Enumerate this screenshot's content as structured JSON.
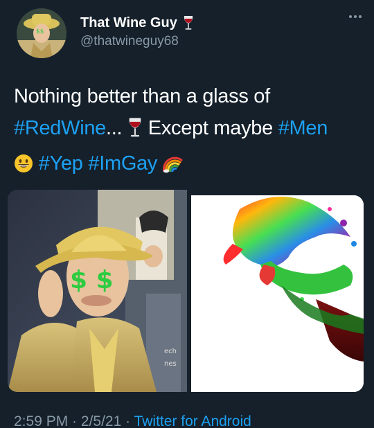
{
  "author": {
    "display_name": "That Wine Guy",
    "handle": "@thatwineguy68"
  },
  "text": {
    "line1": "Nothing better than a glass of",
    "hashtag_redwine": "#RedWine",
    "ellipsis": "...",
    "except": " Except maybe ",
    "hashtag_men": "#Men",
    "hashtag_yep": "#Yep",
    "hashtag_imgay": "#ImGay"
  },
  "meta": {
    "time": "2:59 PM",
    "sep1": " · ",
    "date": "2/5/21",
    "sep2": " · ",
    "source": "Twitter for Android"
  },
  "media": {
    "left_glasses": "$ $",
    "left_side_text": "ech",
    "left_side_text2": "nes"
  },
  "icons": {
    "more": "more-icon",
    "wine": "wine-glass-icon",
    "grin": "grinning-face-icon",
    "rainbow": "rainbow-icon"
  },
  "colors": {
    "background": "#15202b",
    "link": "#1da1f2",
    "muted": "#8899a6"
  }
}
